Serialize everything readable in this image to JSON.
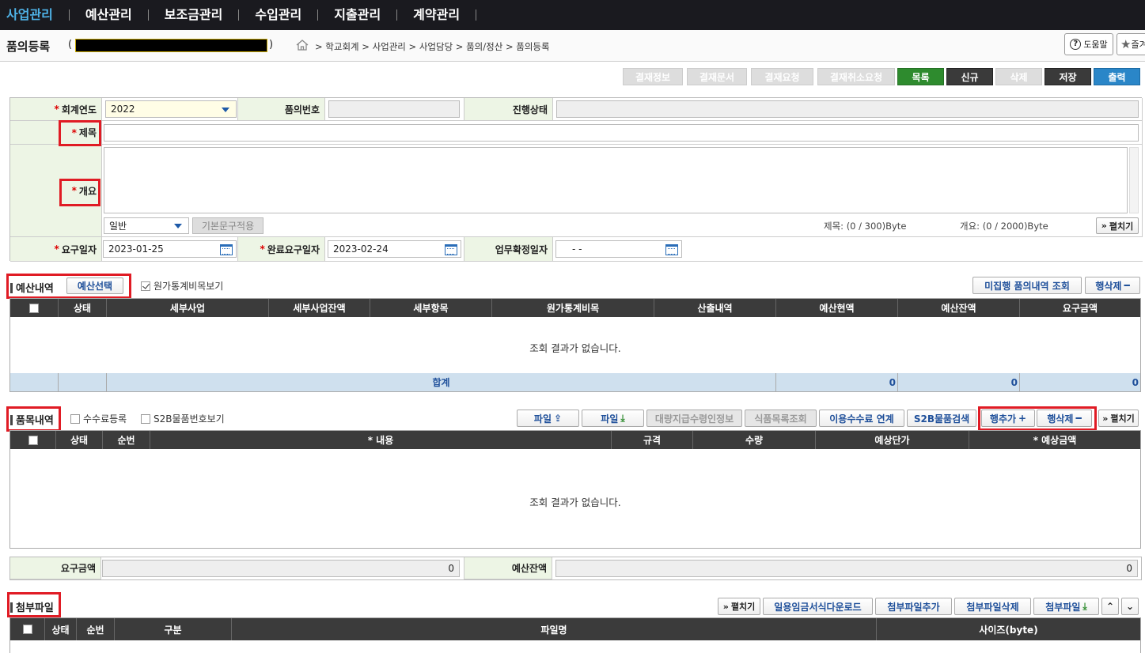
{
  "nav": [
    "사업관리",
    "예산관리",
    "보조금관리",
    "수입관리",
    "지출관리",
    "계약관리"
  ],
  "header": {
    "title": "품의등록",
    "paren_open": "(",
    "paren_close": ")",
    "breadcrumb": "학교회계 > 사업관리 > 사업담당 > 품의/정산 > 품의등록",
    "help": "도움말",
    "favorite": "즐겨"
  },
  "actions": {
    "approval_info": "결재정보",
    "approval_doc": "결재문서",
    "approval_request": "결재요청",
    "approval_cancel": "결재취소요청",
    "list": "목록",
    "new": "신규",
    "delete": "삭제",
    "save": "저장",
    "print": "출력"
  },
  "form": {
    "fiscal_year_label": "회계연도",
    "fiscal_year_value": "2022",
    "doc_no_label": "품의번호",
    "progress_label": "진행상태",
    "title_label": "제목",
    "summary_label": "개요",
    "type_value": "일반",
    "apply_template": "기본문구적용",
    "title_bytes": "제목: (0 / 300)Byte",
    "summary_bytes": "개요: (0 / 2000)Byte",
    "expand": "펼치기",
    "req_date_label": "요구일자",
    "req_date_value": "2023-01-25",
    "done_date_label": "완료요구일자",
    "done_date_value": "2023-02-24",
    "confirm_date_label": "업무확정일자",
    "confirm_date_value": "- -",
    "required_mark": "*"
  },
  "budget": {
    "title": "예산내역",
    "select_btn": "예산선택",
    "cost_view": "원가통계비목보기",
    "unexec_btn": "미집행 품의내역 조회",
    "row_delete": "행삭제",
    "columns": [
      "상태",
      "세부사업",
      "세부사업잔액",
      "세부항목",
      "원가통계비목",
      "산출내역",
      "예산현액",
      "예산잔액",
      "요구금액"
    ],
    "empty": "조회 결과가 없습니다.",
    "total_label": "합계",
    "totals": [
      "0",
      "0",
      "0"
    ]
  },
  "items": {
    "title": "품목내역",
    "fee_reg": "수수료등록",
    "s2b_view": "S2B물품번호보기",
    "file_up": "파일",
    "file_down": "파일",
    "bulk_pay": "대량지급수령인정보",
    "food_list": "식품목록조회",
    "fee_link": "이용수수료 연계",
    "s2b_search": "S2B물품검색",
    "row_add": "행추가",
    "row_delete": "행삭제",
    "expand": "펼치기",
    "columns": [
      "상태",
      "순번",
      "* 내용",
      "규격",
      "수량",
      "예상단가",
      "* 예상금액"
    ],
    "empty": "조회 결과가 없습니다."
  },
  "amounts": {
    "req_label": "요구금액",
    "req_value": "0",
    "remain_label": "예산잔액",
    "remain_value": "0"
  },
  "attach": {
    "title": "첨부파일",
    "expand": "펼치기",
    "wage_download": "일용임금서식다운로드",
    "add": "첨부파일추가",
    "delete": "첨부파일삭제",
    "file": "첨부파일",
    "columns": [
      "상태",
      "순번",
      "구분",
      "파일명",
      "사이즈(byte)"
    ]
  }
}
